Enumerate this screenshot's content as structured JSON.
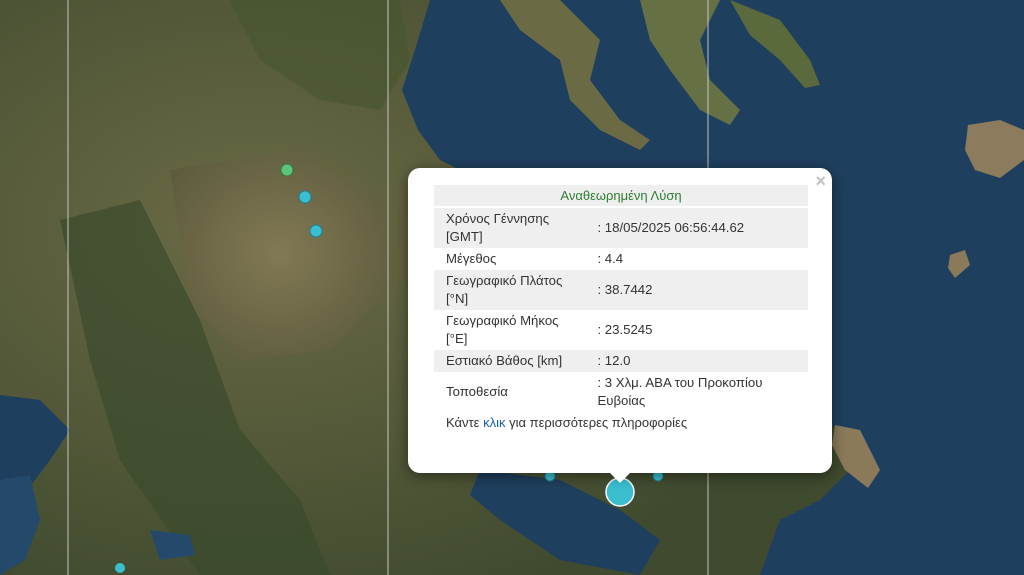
{
  "popup": {
    "title": "Αναθεωρημένη Λύση",
    "close_label": "×",
    "rows": [
      {
        "label": "Χρόνος Γέννησης [GMT]",
        "value": ": 18/05/2025 06:56:44.62"
      },
      {
        "label": "Μέγεθος",
        "value": ": 4.4"
      },
      {
        "label": "Γεωγραφικό Πλάτος [°N]",
        "value": ": 38.7442"
      },
      {
        "label": "Γεωγραφικό Μήκος [°E]",
        "value": ": 23.5245"
      },
      {
        "label": "Εστιακό Βάθος [km]",
        "value": ": 12.0"
      },
      {
        "label": "Τοποθεσία",
        "value": ": 3 Χλμ. ΑΒΑ του Προκοπίου Ευβοίας"
      }
    ],
    "more_prefix": "Κάντε",
    "more_link": "κλικ",
    "more_suffix": "για περισσότερες πληροφορίες"
  },
  "map": {
    "sea_color": "#1f3f5e",
    "land_color": "#5e5a3e",
    "marker_colors": {
      "recent": "#3bbfd0",
      "older": "#5fc47a"
    }
  }
}
